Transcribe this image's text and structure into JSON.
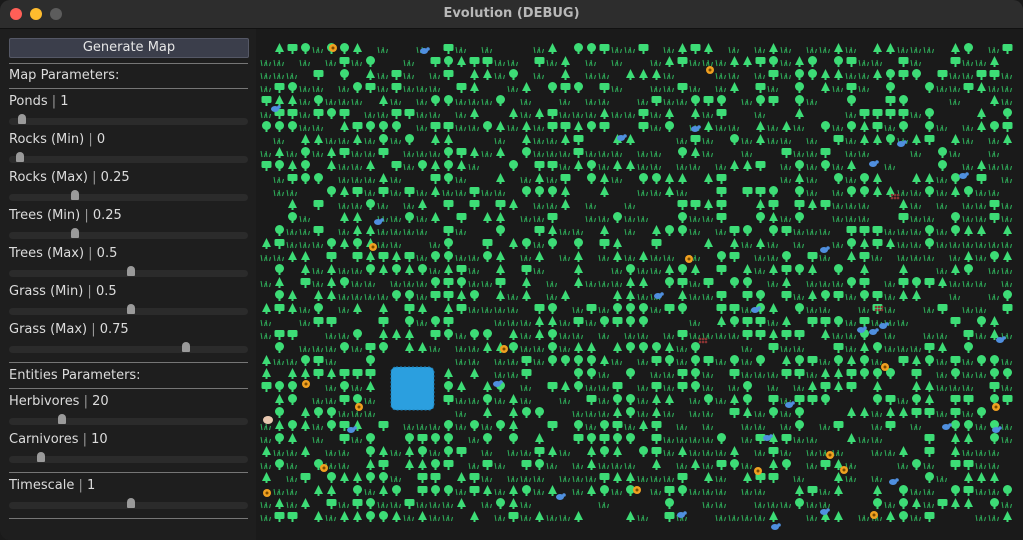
{
  "window": {
    "title": "Evolution (DEBUG)"
  },
  "panel": {
    "generate_button": "Generate Map",
    "map_section": "Map Parameters:",
    "map_params": [
      {
        "name": "Ponds",
        "value": "1",
        "level": 0.04
      },
      {
        "name": "Rocks (Min)",
        "value": "0",
        "level": 0.03
      },
      {
        "name": "Rocks (Max)",
        "value": "0.25",
        "level": 0.27
      },
      {
        "name": "Trees (Min)",
        "value": "0.25",
        "level": 0.27
      },
      {
        "name": "Trees (Max)",
        "value": "0.5",
        "level": 0.51
      },
      {
        "name": "Grass (Min)",
        "value": "0.5",
        "level": 0.51
      },
      {
        "name": "Grass (Max)",
        "value": "0.75",
        "level": 0.75
      }
    ],
    "entity_section": "Entities Parameters:",
    "entity_params": [
      {
        "name": "Herbivores",
        "value": "20",
        "level": 0.21
      },
      {
        "name": "Carnivores",
        "value": "10",
        "level": 0.12
      }
    ],
    "timescale": {
      "name": "Timescale",
      "value": "1",
      "level": 0.51
    }
  },
  "map": {
    "colors": {
      "background": "#1a1a1a",
      "tree": "#3ddc76",
      "grass": "#2fae5a",
      "pond": "#2b9fdf",
      "herbivore": "#4f8fdf",
      "carnivore": "#f0a020",
      "rock": "#8a3434",
      "skull": "#e8c8b0"
    },
    "icons": [
      "tree-icon",
      "grass-icon",
      "pond",
      "herbivore-icon",
      "carnivore-icon",
      "rock-icon"
    ]
  }
}
